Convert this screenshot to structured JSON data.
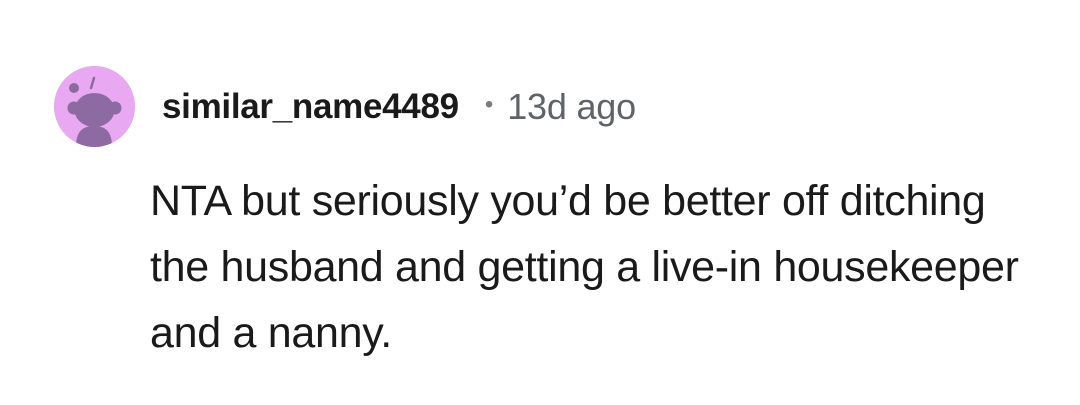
{
  "comment": {
    "avatar_icon": "reddit-snoo-avatar-icon",
    "avatar_color": "#e8a8f2",
    "username": "similar_name4489",
    "separator": "•",
    "timestamp": "13d ago",
    "body": "NTA but seriously you’d be better off ditching the husband and getting a live-in housekeeper and a nanny."
  }
}
